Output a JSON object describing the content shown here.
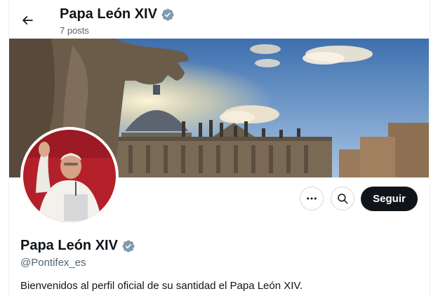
{
  "header": {
    "name": "Papa León XIV",
    "posts": "7 posts"
  },
  "actions": {
    "follow_label": "Seguir"
  },
  "profile": {
    "name": "Papa León XIV",
    "handle": "@Pontifex_es",
    "bio": "Bienvenidos al perfil oficial de su santidad el Papa León XIV."
  },
  "icons": {
    "back": "arrow-left-icon",
    "verified": "verified-badge-icon",
    "more": "more-dots-icon",
    "search": "search-icon"
  },
  "colors": {
    "text": "#0f1419",
    "secondary": "#536471",
    "verified_badge": "#829aab",
    "follow_bg": "#0f1419",
    "border": "#cfd9de"
  }
}
